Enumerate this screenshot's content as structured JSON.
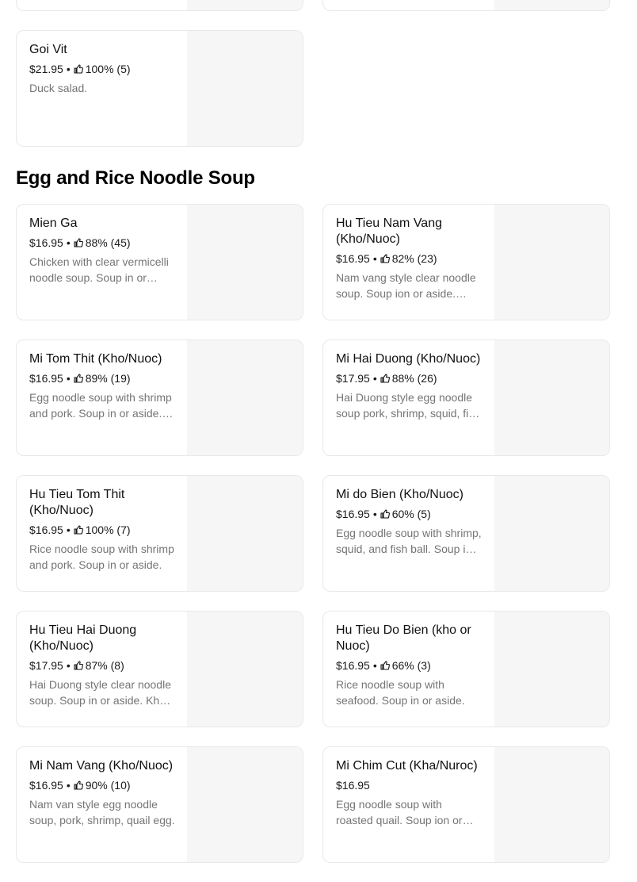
{
  "top_items": [
    {
      "name": "Goi Vit",
      "price": "$21.95",
      "rating": "100% (5)",
      "description": "Duck salad."
    }
  ],
  "section": {
    "title": "Egg and Rice Noodle Soup",
    "items": [
      {
        "name": "Mien Ga",
        "price": "$16.95",
        "rating": "88% (45)",
        "description": "Chicken with clear vermicelli noodle soup. Soup in or aside."
      },
      {
        "name": "Hu Tieu Nam Vang (Kho/Nuoc)",
        "price": "$16.95",
        "rating": "82% (23)",
        "description": "Nam vang style clear noodle soup. Soup ion or aside. Pork, shrimp."
      },
      {
        "name": "Mi Tom Thit (Kho/Nuoc)",
        "price": "$16.95",
        "rating": "89% (19)",
        "description": "Egg noodle soup with shrimp and pork. Soup in or aside. Kho or nuoc."
      },
      {
        "name": "Mi Hai Duong (Kho/Nuoc)",
        "price": "$17.95",
        "rating": "88% (26)",
        "description": "Hai Duong style egg noodle soup pork, shrimp, squid, fish ball."
      },
      {
        "name": "Hu Tieu Tom Thit (Kho/Nuoc)",
        "price": "$16.95",
        "rating": "100% (7)",
        "description": "Rice noodle soup with shrimp and pork. Soup in or aside."
      },
      {
        "name": "Mi do Bien (Kho/Nuoc)",
        "price": "$16.95",
        "rating": "60% (5)",
        "description": "Egg noodle soup with shrimp, squid, and fish ball. Soup in or aside."
      },
      {
        "name": "Hu Tieu Hai Duong (Kho/Nuoc)",
        "price": "$17.95",
        "rating": "87% (8)",
        "description": "Hai Duong style clear noodle soup. Soup in or aside. Kho or nuoc."
      },
      {
        "name": "Hu Tieu Do Bien (kho or Nuoc)",
        "price": "$16.95",
        "rating": "66% (3)",
        "description": "Rice noodle soup with seafood. Soup in or aside."
      },
      {
        "name": "Mi Nam Vang (Kho/Nuoc)",
        "price": "$16.95",
        "rating": "90% (10)",
        "description": "Nam van style egg noodle soup, pork, shrimp, quail egg."
      },
      {
        "name": "Mi Chim Cut (Kha/Nuroc)",
        "price": "$16.95",
        "rating": "",
        "description": "Egg noodle soup with roasted quail. Soup ion or aside."
      }
    ]
  },
  "colors": {
    "card_border": "#e8e8e8",
    "image_placeholder": "#f6f6f6",
    "description": "#757575"
  },
  "icons": {
    "rating": "thumbs-up-icon"
  }
}
